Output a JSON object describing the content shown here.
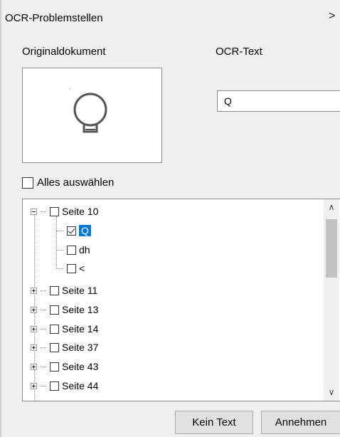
{
  "window": {
    "title": "OCR-Problemstellen",
    "close_label": "×"
  },
  "original": {
    "label": "Originaldokument",
    "image_icon": "bulb-icon"
  },
  "ocr": {
    "label": "OCR-Text",
    "value": "Q"
  },
  "select_all": {
    "label": "Alles auswählen",
    "checked": false
  },
  "tree": {
    "items": [
      {
        "label": "Seite 10",
        "expanded": true,
        "checked": false,
        "children": [
          {
            "label": "Q",
            "checked": true,
            "selected": true
          },
          {
            "label": "dh",
            "checked": false
          },
          {
            "label": "<",
            "checked": false
          }
        ]
      },
      {
        "label": "Seite 11",
        "expanded": false,
        "checked": false
      },
      {
        "label": "Seite 13",
        "expanded": false,
        "checked": false
      },
      {
        "label": "Seite 14",
        "expanded": false,
        "checked": false
      },
      {
        "label": "Seite 37",
        "expanded": false,
        "checked": false
      },
      {
        "label": "Seite 43",
        "expanded": false,
        "checked": false
      },
      {
        "label": "Seite 44",
        "expanded": false,
        "checked": false
      }
    ]
  },
  "buttons": {
    "no_text": "Kein Text",
    "accept": "Annehmen"
  }
}
